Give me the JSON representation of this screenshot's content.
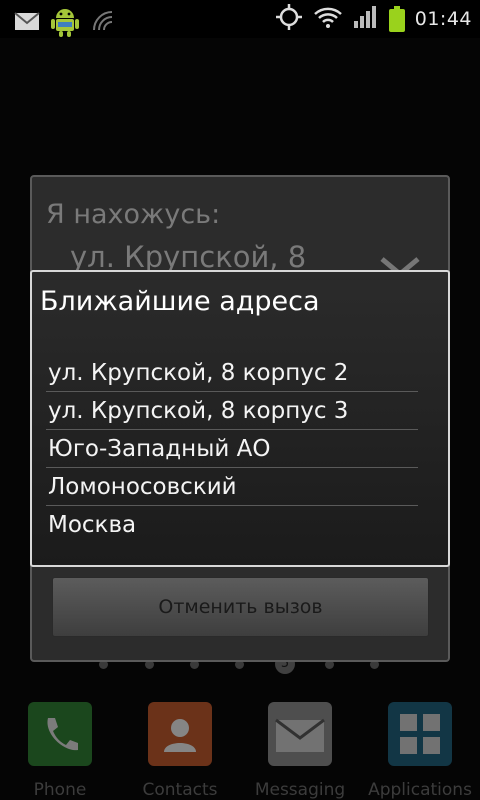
{
  "status_bar": {
    "time": "01:44",
    "icons": [
      "gmail-icon",
      "android-icon",
      "wireless-sync-icon",
      "gps-icon",
      "wifi-icon",
      "signal-icon",
      "battery-icon"
    ],
    "battery_color": "#9ad21c"
  },
  "background_dialog": {
    "title": "Я нахожусь:",
    "address": "ул. Крупской, 8",
    "cancel_label": "Отменить вызов"
  },
  "nearest_dialog": {
    "title": "Ближайшие адреса",
    "items": [
      "ул. Крупской, 8 корпус 2",
      "ул. Крупской, 8 корпус 3",
      "Юго-Западный АО",
      "Ломоносовский",
      "Москва"
    ]
  },
  "home": {
    "active_page": "5",
    "dock": [
      {
        "label": "Phone",
        "icon": "phone-icon",
        "color": "#2e7d32"
      },
      {
        "label": "Contacts",
        "icon": "contacts-icon",
        "color": "#c0572a"
      },
      {
        "label": "Messaging",
        "icon": "messaging-icon",
        "color": "#8a8a8a"
      },
      {
        "label": "Applications",
        "icon": "applications-grid-icon",
        "color": "#1d5f7a"
      }
    ]
  }
}
